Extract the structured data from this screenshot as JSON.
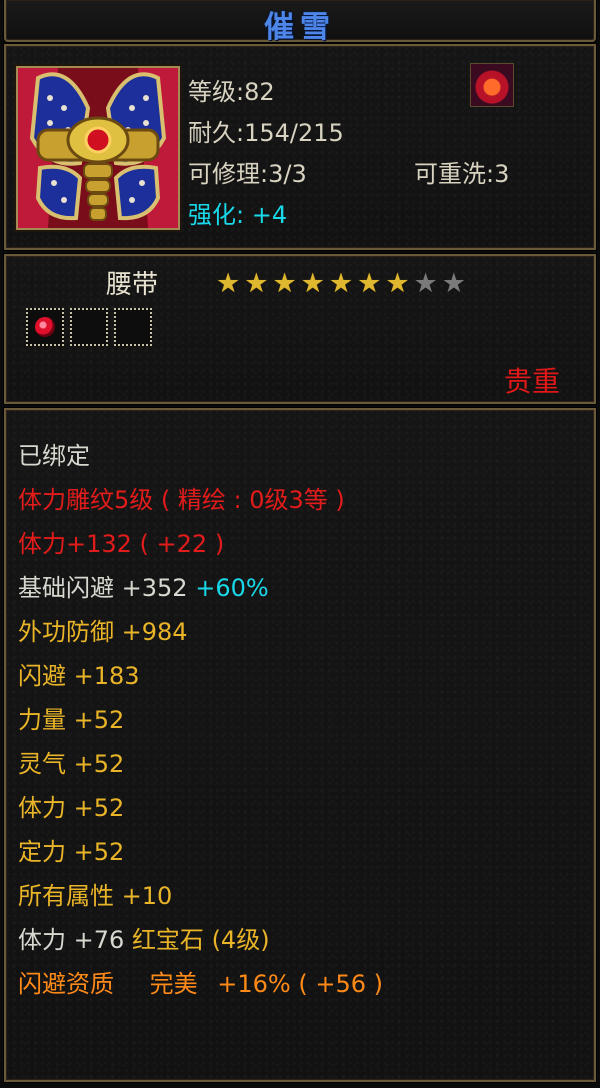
{
  "title": "催雪",
  "info": {
    "level": "等级:82",
    "durability": "耐久:154/215",
    "repairable": "可修理:3/3",
    "rewash": "可重洗:3",
    "enhance": "强化: +4",
    "gem_icon": "fire-gem-icon",
    "item_icon": "belt-item-icon"
  },
  "equip": {
    "type": "腰带",
    "stars_total": 9,
    "stars_lit": 7,
    "slots": [
      "filled",
      "empty",
      "empty"
    ],
    "rarity": "贵重"
  },
  "attributes": {
    "bound": "已绑定",
    "carving": "体力雕纹5级 ( 精绘 : 0级3等 )",
    "stamina_bonus": "体力+132 ( +22 )",
    "base_dodge_label": "基础闪避",
    "base_dodge_value": "+352",
    "base_dodge_pct": "+60%",
    "ext_defense": "外功防御 +984",
    "dodge": "闪避  +183",
    "strength": "力量  +52",
    "spirit": "灵气  +52",
    "stamina": "体力  +52",
    "focus": "定力  +52",
    "all_attr": "所有属性 +10",
    "gem_stamina_label": "体力",
    "gem_stamina_value": "+76",
    "gem_name": "红宝石 (4级)",
    "aptitude_label": "闪避资质",
    "aptitude_quality": "完美",
    "aptitude_value": "+16%  ( +56 )"
  },
  "colors": {
    "title": "#4d86e8",
    "bound": "#d8d8d0",
    "red": "#e21b1b",
    "yellow": "#e9b428",
    "cyan": "#19d8e8",
    "orange": "#ff8a18",
    "star_on": "#e0b830",
    "star_off": "#7a7a7a"
  }
}
